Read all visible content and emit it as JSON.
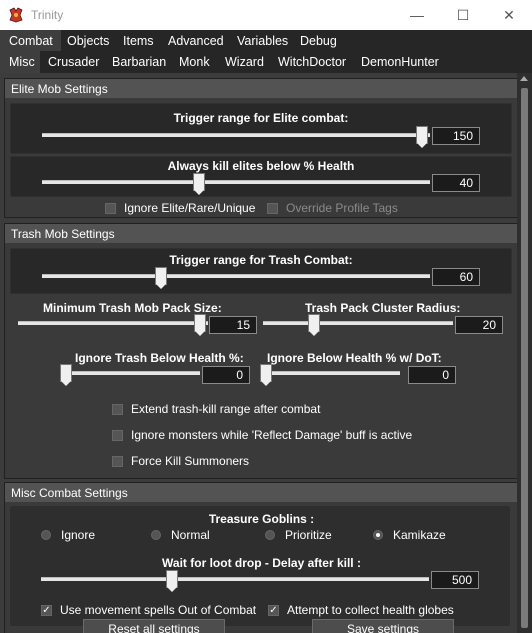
{
  "window": {
    "title": "Trinity",
    "minimize_glyph": "—",
    "maximize_glyph": "☐",
    "close_glyph": "✕"
  },
  "menu": [
    "Combat",
    "Objects",
    "Items",
    "Advanced",
    "Variables",
    "Debug"
  ],
  "tabs": [
    "Misc",
    "Crusader",
    "Barbarian",
    "Monk",
    "Wizard",
    "WitchDoctor",
    "DemonHunter"
  ],
  "elite": {
    "header": "Elite Mob Settings",
    "trigger_label": "Trigger range for Elite combat:",
    "trigger_value": "150",
    "health_label": "Always kill elites below % Health",
    "health_value": "40",
    "ignore_label": "Ignore Elite/Rare/Unique",
    "override_label": "Override Profile Tags"
  },
  "trash": {
    "header": "Trash Mob Settings",
    "trigger_label": "Trigger range for Trash Combat:",
    "trigger_value": "60",
    "pack_label": "Minimum Trash Mob Pack Size:",
    "pack_value": "15",
    "cluster_label": "Trash Pack Cluster Radius:",
    "cluster_value": "20",
    "below_health_label": "Ignore Trash Below Health %:",
    "below_health_value": "0",
    "below_dot_label": "Ignore Below Health % w/ DoT:",
    "below_dot_value": "0",
    "extend_label": "Extend trash-kill range after combat",
    "reflect_label": "Ignore monsters while 'Reflect Damage' buff is active",
    "summoners_label": "Force Kill Summoners"
  },
  "misc": {
    "header": "Misc Combat Settings",
    "goblins_label": "Treasure Goblins :",
    "goblin_options": [
      "Ignore",
      "Normal",
      "Prioritize",
      "Kamikaze"
    ],
    "goblin_selected": "Kamikaze",
    "loot_label": "Wait for loot drop - Delay after kill :",
    "loot_value": "500",
    "movement_label": "Use movement spells Out of Combat",
    "globes_label": "Attempt to collect health globes"
  },
  "buttons": {
    "reset": "Reset all settings",
    "save": "Save settings"
  },
  "sliders": {
    "elite_trigger": 0.99,
    "elite_health": 0.4,
    "trash_trigger": 0.3,
    "pack_size": 0.98,
    "cluster_radius": 0.25,
    "below_health": 0.0,
    "below_dot": 0.0,
    "loot_delay": 0.33
  },
  "colors": {
    "background": "#3c3c3c",
    "panel": "#282828",
    "header": "#535353",
    "logo": "#c0392b"
  }
}
